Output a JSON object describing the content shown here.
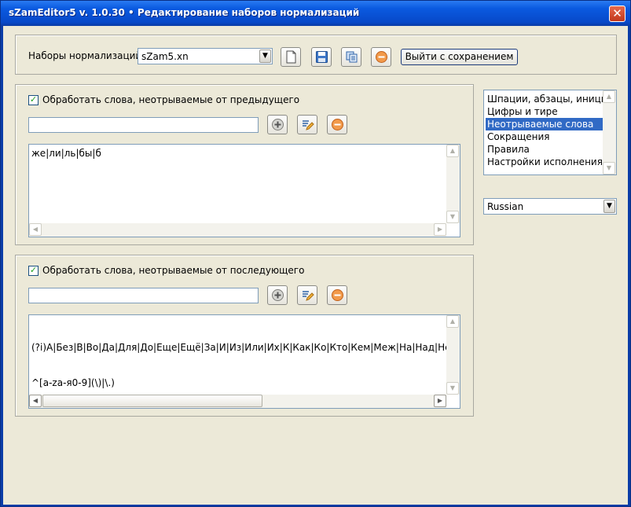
{
  "window": {
    "title": "sZamEditor5 v. 1.0.30 • Редактирование наборов нормализаций",
    "close_glyph": "✕"
  },
  "toolbar": {
    "sets_label": "Наборы нормализаций",
    "sets_value": "sZam5.xn",
    "exit_save_label": "Выйти с сохранением",
    "icons": [
      "new-file-icon",
      "save-disk-icon",
      "copy-icon",
      "delete-icon"
    ]
  },
  "section_prev": {
    "checkbox_label": "Обработать слова, неотрываемые от предыдущего",
    "checked": true,
    "input_value": "",
    "memo_text": "же|ли|ль|бы|б"
  },
  "section_next": {
    "checkbox_label": "Обработать слова, неотрываемые от последующего",
    "checked": true,
    "input_value": "",
    "memo_line1": "(?i)А|Без|В|Во|Да|Для|До|Еще|Ещё|За|И|Из|Или|Их|К|Как|Ко|Кто|Кем|Меж|На|Над|Не|Ни|Н",
    "memo_line2": "^[a-za-я0-9](\\)|\\.)"
  },
  "categories": {
    "items": [
      "Шпации, абзацы, инициал",
      "Цифры и тире",
      "Неотрываемые слова",
      "Сокращения",
      "Правила",
      "Настройки исполнения"
    ],
    "selected_index": 2
  },
  "language": {
    "value": "Russian"
  },
  "glyphs": {
    "arrow_down": "▼",
    "arrow_up": "▲",
    "arrow_left": "◀",
    "arrow_right": "▶",
    "check": "✓"
  }
}
